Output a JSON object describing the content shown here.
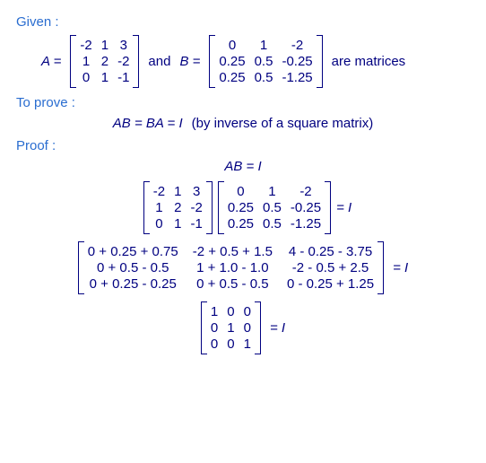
{
  "headings": {
    "given": "Given :",
    "to_prove": "To prove :",
    "proof": "Proof :"
  },
  "labels": {
    "A_eq": "A  =",
    "and": "and",
    "B_eq": "B  =",
    "are_matrices": "are matrices",
    "prove_left": "AB  =  BA  =  I",
    "prove_note": "(by inverse of a square matrix)",
    "ab_eq_i": "AB  =  I",
    "eq_i": "=  I"
  },
  "matA": {
    "r0": {
      "c0": "-2",
      "c1": "1",
      "c2": "3"
    },
    "r1": {
      "c0": "1",
      "c1": "2",
      "c2": "-2"
    },
    "r2": {
      "c0": "0",
      "c1": "1",
      "c2": "-1"
    }
  },
  "matB": {
    "r0": {
      "c0": "0",
      "c1": "1",
      "c2": "-2"
    },
    "r1": {
      "c0": "0.25",
      "c1": "0.5",
      "c2": "-0.25"
    },
    "r2": {
      "c0": "0.25",
      "c1": "0.5",
      "c2": "-1.25"
    }
  },
  "expand": {
    "r0": {
      "c0": "0 + 0.25 + 0.75",
      "c1": "-2 + 0.5 + 1.5",
      "c2": "4 - 0.25 - 3.75"
    },
    "r1": {
      "c0": "0 + 0.5 - 0.5",
      "c1": "1 + 1.0 - 1.0",
      "c2": "-2 - 0.5 + 2.5"
    },
    "r2": {
      "c0": "0 + 0.25 - 0.25",
      "c1": "0 + 0.5 - 0.5",
      "c2": "0 - 0.25 + 1.25"
    }
  },
  "identity": {
    "r0": {
      "c0": "1",
      "c1": "0",
      "c2": "0"
    },
    "r1": {
      "c0": "0",
      "c1": "1",
      "c2": "0"
    },
    "r2": {
      "c0": "0",
      "c1": "0",
      "c2": "1"
    }
  },
  "chart_data": {
    "type": "table",
    "title": "Matrix inverse verification AB = BA = I",
    "A": [
      [
        -2,
        1,
        3
      ],
      [
        1,
        2,
        -2
      ],
      [
        0,
        1,
        -1
      ]
    ],
    "B": [
      [
        0,
        1,
        -2
      ],
      [
        0.25,
        0.5,
        -0.25
      ],
      [
        0.25,
        0.5,
        -1.25
      ]
    ],
    "I": [
      [
        1,
        0,
        0
      ],
      [
        0,
        1,
        0
      ],
      [
        0,
        0,
        1
      ]
    ]
  }
}
